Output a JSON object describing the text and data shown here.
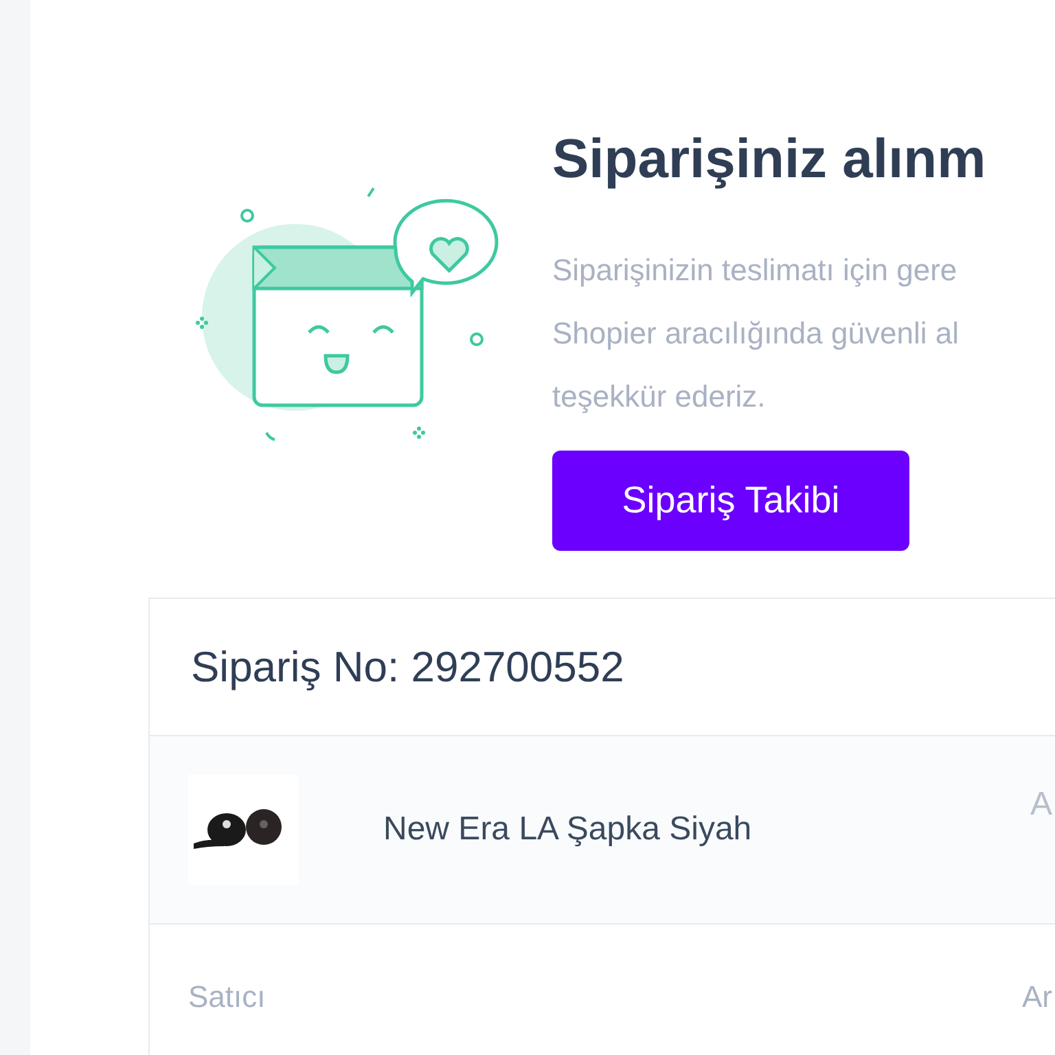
{
  "title": "Siparişiniz alınm",
  "message_lines": [
    "Siparişinizin teslimatı için gere",
    "Shopier aracılığında güvenli al",
    "teşekkür ederiz."
  ],
  "track_button": "Sipariş Takibi",
  "order": {
    "number_label": "Sipariş No: 292700552",
    "product": {
      "name": "New Era LA Şapka Siyah",
      "column_3": "A"
    },
    "seller": {
      "label": "Satıcı",
      "column_2": "Ar"
    }
  }
}
